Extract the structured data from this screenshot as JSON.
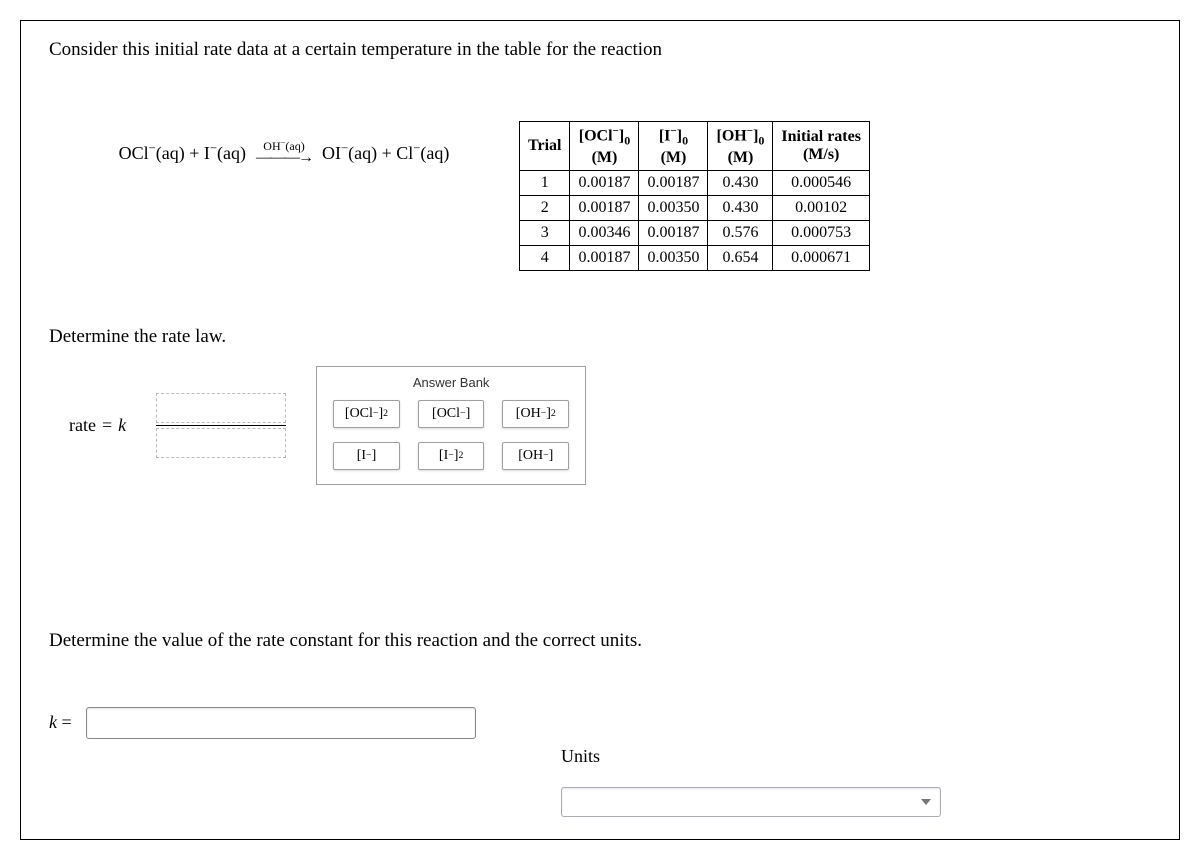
{
  "intro": "Consider this initial rate data at a certain temperature in the table for the reaction",
  "equation": {
    "lhs": "OCl⁻(aq) + I⁻(aq)",
    "over_arrow": "OH⁻(aq)",
    "rhs": "OI⁻(aq) + Cl⁻(aq)"
  },
  "table": {
    "headers": {
      "trial": "Trial",
      "c1_top": "[OCl⁻]₀",
      "c1_bot": "(M)",
      "c2_top": "[I⁻]₀",
      "c2_bot": "(M)",
      "c3_top": "[OH⁻]₀",
      "c3_bot": "(M)",
      "c4_top": "Initial rates",
      "c4_bot": "(M/s)"
    },
    "rows": [
      {
        "trial": "1",
        "ocl": "0.00187",
        "i": "0.00187",
        "oh": "0.430",
        "rate": "0.000546"
      },
      {
        "trial": "2",
        "ocl": "0.00187",
        "i": "0.00350",
        "oh": "0.430",
        "rate": "0.00102"
      },
      {
        "trial": "3",
        "ocl": "0.00346",
        "i": "0.00187",
        "oh": "0.576",
        "rate": "0.000753"
      },
      {
        "trial": "4",
        "ocl": "0.00187",
        "i": "0.00350",
        "oh": "0.654",
        "rate": "0.000671"
      }
    ]
  },
  "section2": {
    "prompt": "Determine the rate law.",
    "rate_eq_prefix": "rate = k",
    "bank_title": "Answer Bank",
    "tiles": [
      "[OCl⁻]²",
      "[OCl⁻]",
      "[OH⁻]²",
      "[I⁻]",
      "[I⁻]²",
      "[OH⁻]"
    ]
  },
  "section3": {
    "prompt": "Determine the value of the rate constant for this reaction and the correct units.",
    "k_label": "k =",
    "units_label": "Units",
    "k_value": "",
    "units_value": ""
  }
}
